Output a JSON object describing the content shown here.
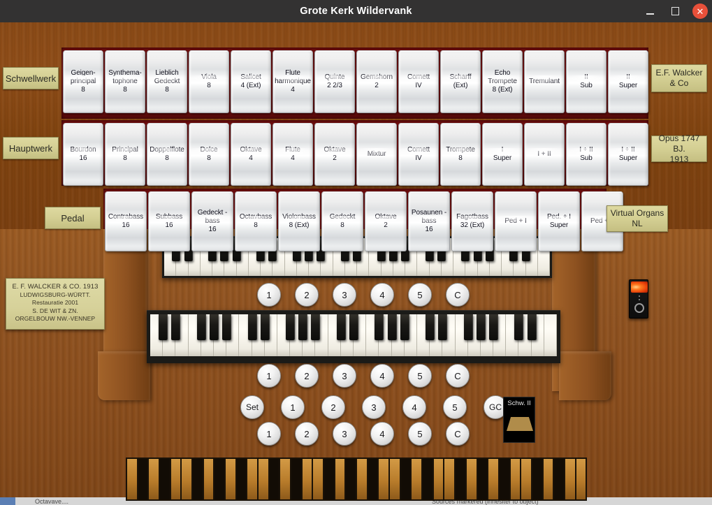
{
  "window": {
    "title": "Grote Kerk Wildervank",
    "minimize_label": "–",
    "maximize_label": "❐",
    "close_label": "✕"
  },
  "divisions": [
    {
      "plate": "Schwellwerk",
      "stops": [
        "Geigen-\nprincipal\n8",
        "Synthema-\ntophone\n8",
        "Lieblich\nGedeckt\n8",
        "Viola\n8",
        "Salicet\n4 (Ext)",
        "Flute\nharmonique\n4",
        "Quinte\n2 2/3",
        "Gemshorn\n2",
        "Cornett\nIV",
        "Scharff\n(Ext)",
        "Echo\nTrompete\n8 (Ext)",
        "Tremulant",
        "II\nSub",
        "II\nSuper"
      ]
    },
    {
      "plate": "Hauptwerk",
      "stops": [
        "Bourdon\n16",
        "Principal\n8",
        "Doppelflote\n8",
        "Dolce\n8",
        "Oktave\n4",
        "Flute\n4",
        "Oktave\n2",
        "Mixtur",
        "Cornett\nIV",
        "Trompete\n8",
        "I\nSuper",
        "I + II",
        "I + II\nSub",
        "I + II\nSuper"
      ]
    },
    {
      "plate": "Pedal",
      "stops": [
        "Contrabass\n16",
        "Subbass\n16",
        "Gedeckt -\nbass\n16",
        "Octavbass\n8",
        "Violonbass\n8 (Ext)",
        "Gedeckt\n8",
        "Oktave\n2",
        "Posaunen -\nbass\n16",
        "Fagotbass\n32 (Ext)",
        "Ped + I",
        "Ped. + I\nSuper",
        "Ped + II"
      ]
    }
  ],
  "plates": {
    "builder": "E.F. Walcker\n& Co",
    "opus": "Opus 1747 BJ.\n1913",
    "virtual_organs": "Virtual Organs\nNL"
  },
  "nameplate": {
    "line1": "E. F. WALCKER & CO. 1913",
    "line2": "LUDWIGSBURG-WÜRTT.",
    "line3": "Restauratie  2001",
    "line4": "S. DE WIT & ZN.",
    "line5": "ORGELBOUW  NW.-VENNEP"
  },
  "pistons": {
    "upper_manual": [
      "1",
      "2",
      "3",
      "4",
      "5",
      "C"
    ],
    "lower_manual": [
      "1",
      "2",
      "3",
      "4",
      "5",
      "C"
    ],
    "general_row": [
      "Set",
      "1",
      "2",
      "3",
      "4",
      "5",
      "GC"
    ],
    "bottom_row": [
      "1",
      "2",
      "3",
      "4",
      "5",
      "C"
    ]
  },
  "swell_indicator": {
    "label": "Schw. II"
  },
  "power": {
    "name": "power-switch"
  },
  "background_window": {
    "left_text": "Octavave....",
    "right_text": "Sources  markered  (inhesiter  to object)"
  }
}
